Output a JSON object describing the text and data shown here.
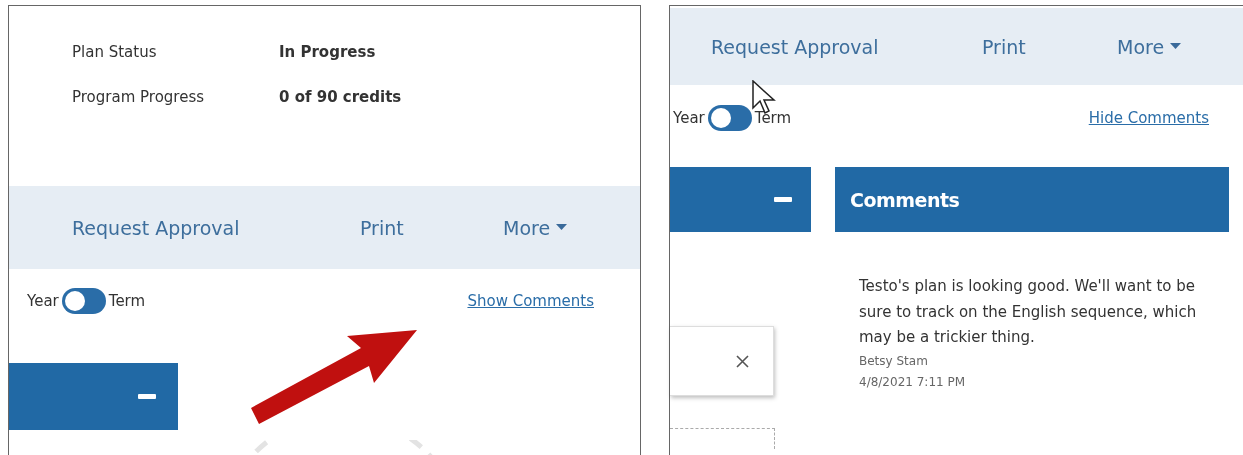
{
  "left_panel": {
    "summary": [
      {
        "label": "Plan Status",
        "value": "In Progress"
      },
      {
        "label": "Program Progress",
        "value": "0 of 90 credits"
      }
    ],
    "actions": [
      "Request Approval",
      "Print",
      "More"
    ],
    "view_toggle": {
      "left_label": "Year",
      "right_label": "Term",
      "on": false
    },
    "comments_link": "Show Comments"
  },
  "right_panel": {
    "actions": [
      "Request Approval",
      "Print",
      "More"
    ],
    "view_toggle": {
      "left_label": "Year",
      "right_label": "Term",
      "on": false
    },
    "comments_link": "Hide Comments",
    "comments_header": "Comments",
    "comments": [
      {
        "text": "Testo's plan is looking good. We'll want to be sure to track on the English sequence, which may be a trickier thing.",
        "author": "Betsy Stam",
        "date": "4/8/2021 7:11 PM"
      }
    ]
  }
}
